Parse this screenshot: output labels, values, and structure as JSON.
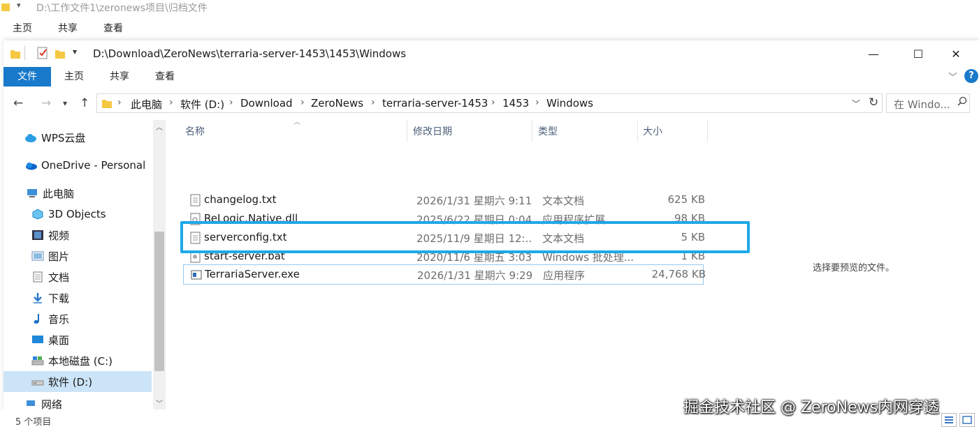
{
  "background_window": {
    "path": "D:\\工作文件1\\zeronews项目\\归档文件",
    "tabs": [
      "主页",
      "共享",
      "查看"
    ]
  },
  "window": {
    "title_path": "D:\\Download\\ZeroNews\\terraria-server-1453\\1453\\Windows",
    "minimize": "—",
    "maximize": "☐",
    "close": "✕"
  },
  "ribbon": {
    "tabs": [
      "文件",
      "主页",
      "共享",
      "查看"
    ]
  },
  "breadcrumb": [
    "此电脑",
    "软件 (D:)",
    "Download",
    "ZeroNews",
    "terraria-server-1453",
    "1453",
    "Windows"
  ],
  "search": {
    "placeholder": "在 Windo..."
  },
  "sidebar": {
    "items": [
      {
        "label": "WPS云盘",
        "icon": "cloud-icon"
      },
      {
        "label": "OneDrive - Personal",
        "icon": "onedrive-icon"
      },
      {
        "label": "此电脑",
        "icon": "computer-icon"
      },
      {
        "label": "3D Objects",
        "icon": "3d-objects-icon"
      },
      {
        "label": "视频",
        "icon": "video-icon"
      },
      {
        "label": "图片",
        "icon": "pictures-icon"
      },
      {
        "label": "文档",
        "icon": "documents-icon"
      },
      {
        "label": "下载",
        "icon": "download-icon"
      },
      {
        "label": "音乐",
        "icon": "music-icon"
      },
      {
        "label": "桌面",
        "icon": "desktop-icon"
      },
      {
        "label": "本地磁盘 (C:)",
        "icon": "drive-icon"
      },
      {
        "label": "软件 (D:)",
        "icon": "drive-icon"
      },
      {
        "label": "网络",
        "icon": "network-icon"
      }
    ]
  },
  "columns": {
    "name": "名称",
    "date": "修改日期",
    "type": "类型",
    "size": "大小"
  },
  "files": [
    {
      "name": "changelog.txt",
      "date": "2026/1/31 星期六 9:11",
      "type": "文本文档",
      "size": "625 KB",
      "icon": "text-file-icon"
    },
    {
      "name": "ReLogic.Native.dll",
      "date": "2025/6/22 星期日 0:04",
      "type": "应用程序扩展",
      "size": "98 KB",
      "icon": "dll-file-icon"
    },
    {
      "name": "serverconfig.txt",
      "date": "2025/11/9 星期日 12:...",
      "type": "文本文档",
      "size": "5 KB",
      "icon": "text-file-icon"
    },
    {
      "name": "start-server.bat",
      "date": "2020/11/6 星期五 3:03",
      "type": "Windows 批处理...",
      "size": "1 KB",
      "icon": "batch-file-icon"
    },
    {
      "name": "TerrariaServer.exe",
      "date": "2026/1/31 星期六 9:29",
      "type": "应用程序",
      "size": "24,768 KB",
      "icon": "exe-file-icon"
    }
  ],
  "preview_message": "选择要预览的文件。",
  "status": {
    "item_count": "5 个项目"
  },
  "watermark": "掘金技术社区 @ ZeroNews内网穿透",
  "colors": {
    "accent": "#1979ca",
    "highlight_box": "#1fa9e6",
    "selected_nav": "#cce4f7"
  }
}
